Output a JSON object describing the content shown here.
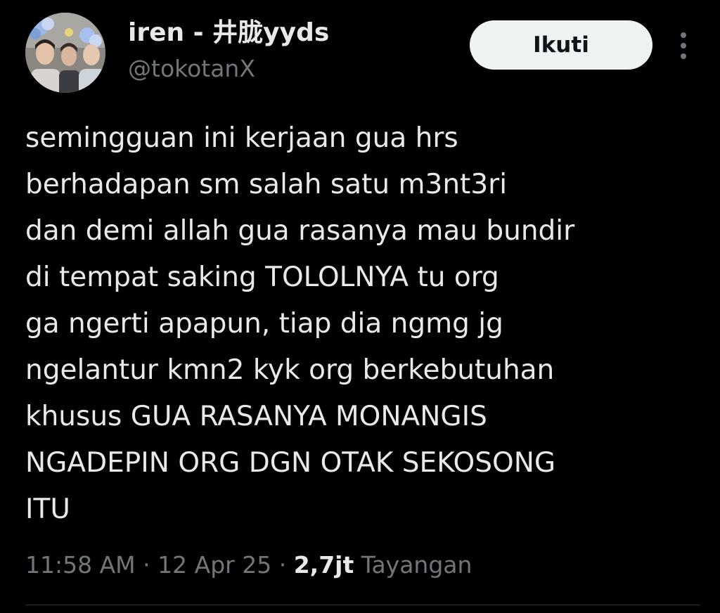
{
  "user": {
    "display_name": "iren - 井胧yyds",
    "handle": "@tokotanX",
    "avatar_icon": "profile-photo"
  },
  "follow_button": {
    "label": "Ikuti"
  },
  "more_icon": "more-vertical-icon",
  "tweet": {
    "text": "semingguan ini kerjaan gua hrs\nberhadapan sm salah satu m3nt3ri\ndan demi allah gua rasanya mau bundir\ndi tempat saking TOLOLNYA tu org\nga ngerti apapun, tiap dia ngmg jg\nngelantur kmn2 kyk org berkebutuhan\nkhusus GUA RASANYA MONANGIS\nNGADEPIN ORG DGN OTAK SEKOSONG\nITU"
  },
  "meta": {
    "time": "11:58 AM",
    "separator": "·",
    "date": "12 Apr 25",
    "views_count": "2,7jt",
    "views_label": "Tayangan"
  },
  "colors": {
    "background": "#000000",
    "text_primary": "#e7e9ea",
    "text_secondary": "#71767b",
    "button_bg": "#eff3f4",
    "button_text": "#0f1419",
    "divider": "#2f3336"
  }
}
